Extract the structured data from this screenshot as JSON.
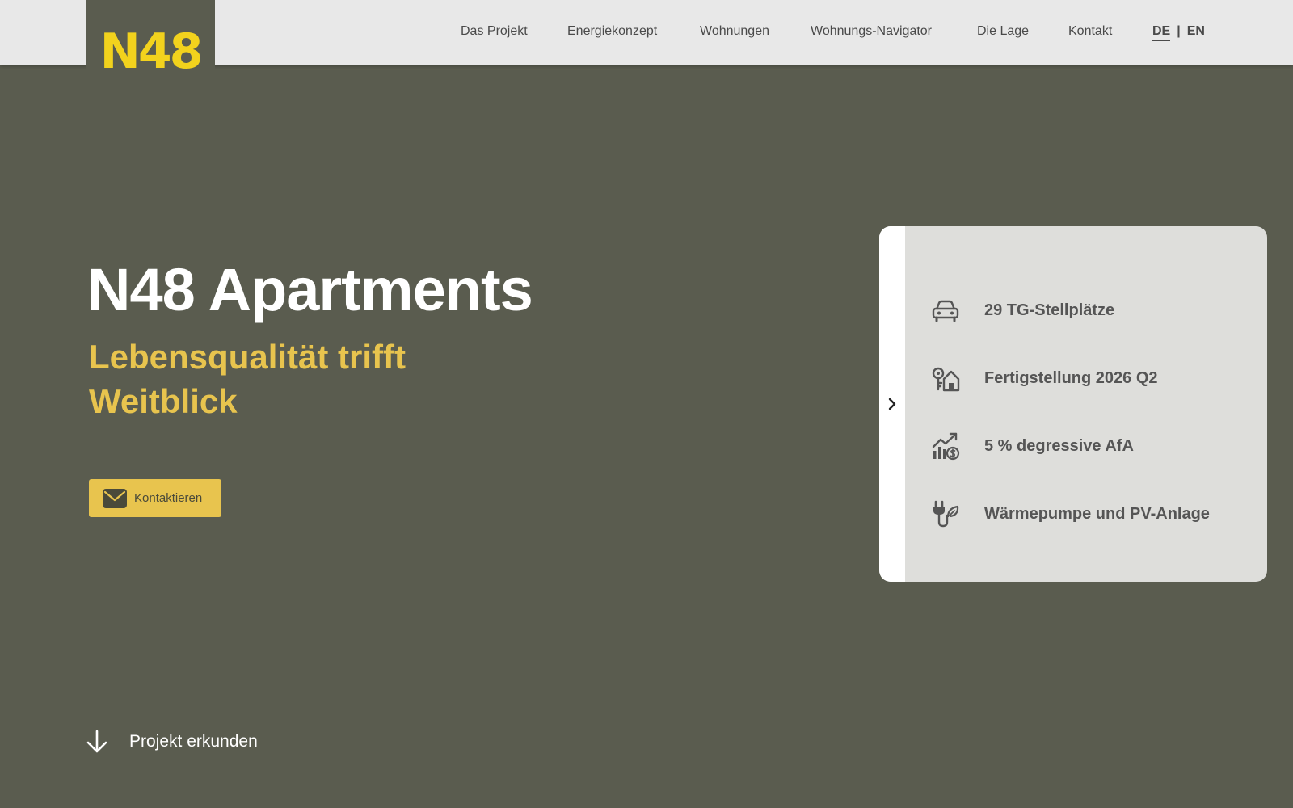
{
  "brand": {
    "logo_text": "N48",
    "logo_color": "#f2d21d"
  },
  "nav": {
    "items": [
      {
        "label": "Das Projekt"
      },
      {
        "label": "Energiekonzept"
      },
      {
        "label": "Wohnungen"
      },
      {
        "label": "Wohnungs-Navigator"
      },
      {
        "label": "Die Lage"
      },
      {
        "label": "Kontakt"
      }
    ],
    "lang": {
      "active": "DE",
      "separator": "|",
      "other": "EN"
    }
  },
  "hero": {
    "title": "N48 Apartments",
    "subtitle": "Lebensqualität trifft Weitblick",
    "cta_label": "Kontaktieren",
    "cta_icon": "envelope-icon",
    "explore_label": "Projekt erkunden",
    "explore_icon": "arrow-down-icon"
  },
  "features": {
    "toggle_icon": "chevron-right-icon",
    "items": [
      {
        "label": "29 TG-Stellplätze",
        "icon": "car-icon"
      },
      {
        "label": "Fertigstellung 2026 Q2",
        "icon": "house-key-icon"
      },
      {
        "label": "5 % degressive AfA",
        "icon": "growth-chart-icon"
      },
      {
        "label": "Wärmepumpe und PV-Anlage",
        "icon": "eco-plug-icon"
      }
    ]
  },
  "colors": {
    "background": "#5a5c4f",
    "topbar": "#e8e8e8",
    "accent_yellow": "#e8c44e",
    "card": "#dededb"
  }
}
